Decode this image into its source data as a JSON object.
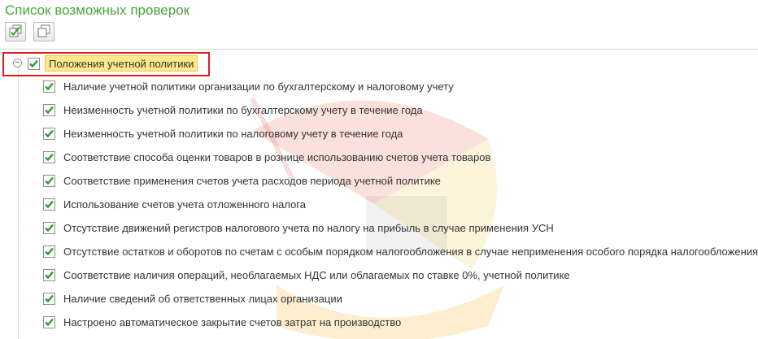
{
  "panel": {
    "title": "Список возможных проверок"
  },
  "toolbar": {
    "buttons": [
      {
        "icon": "check-all-icon"
      },
      {
        "icon": "uncheck-all-icon"
      }
    ]
  },
  "tree": {
    "group": {
      "label": "Положения учетной политики",
      "checked": true,
      "expanded": true
    },
    "items": [
      {
        "label": "Наличие учетной политики организации по бухгалтерскому и налоговому учету",
        "checked": true
      },
      {
        "label": "Неизменность учетной политики по бухгалтерскому учету в течение года",
        "checked": true
      },
      {
        "label": "Неизменность учетной политики по налоговому учету в течение года",
        "checked": true
      },
      {
        "label": "Соответствие способа оценки товаров в рознице использованию счетов учета товаров",
        "checked": true
      },
      {
        "label": "Соответствие применения счетов учета расходов периода учетной политике",
        "checked": true
      },
      {
        "label": "Использование счетов учета отложенного налога",
        "checked": true
      },
      {
        "label": "Отсутствие движений регистров налогового учета по налогу на прибыль в случае применения УСН",
        "checked": true
      },
      {
        "label": "Отсутствие остатков и оборотов по счетам с особым порядком налогообложения в случае неприменения особого порядка налогообложения",
        "checked": true
      },
      {
        "label": "Соответствие наличия операций, необлагаемых НДС или облагаемых по ставке 0%, учетной политике",
        "checked": true
      },
      {
        "label": "Наличие сведений об ответственных лицах организации",
        "checked": true
      },
      {
        "label": "Настроено автоматическое закрытие счетов затрат на производство",
        "checked": true
      }
    ]
  },
  "colors": {
    "title": "#4aa33f",
    "check": "#2e9a2e",
    "highlight": "#e01b1b",
    "selection": "#fbe98a"
  }
}
